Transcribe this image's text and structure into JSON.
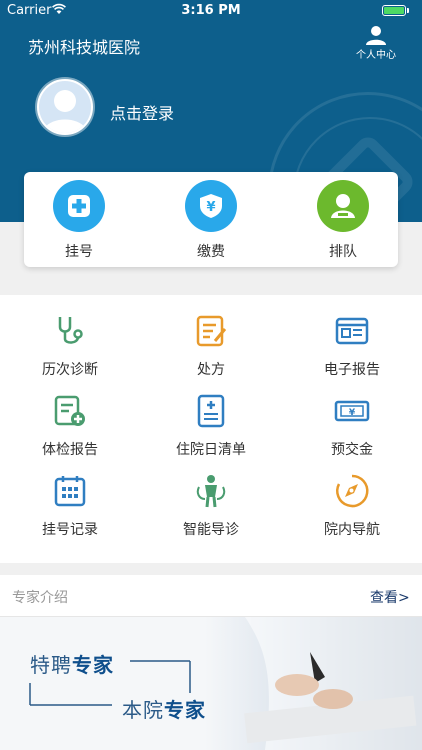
{
  "status_bar": {
    "carrier": "Carrier",
    "time": "3:16 PM",
    "battery_level": 1.0
  },
  "header": {
    "title": "苏州科技城医院",
    "personal_center_label": "个人中心",
    "login_text": "点击登录"
  },
  "quick_actions": [
    {
      "label": "挂号",
      "icon": "plus-badge-icon",
      "color": "#29a8ea"
    },
    {
      "label": "缴费",
      "icon": "yen-shield-icon",
      "color": "#29a8ea"
    },
    {
      "label": "排队",
      "icon": "person-queue-icon",
      "color": "#6cb92d"
    }
  ],
  "services": [
    {
      "label": "历次诊断",
      "icon": "stethoscope-icon"
    },
    {
      "label": "处方",
      "icon": "prescription-icon"
    },
    {
      "label": "电子报告",
      "icon": "e-report-icon"
    },
    {
      "label": "体检报告",
      "icon": "checkup-report-icon"
    },
    {
      "label": "住院日清单",
      "icon": "inpatient-list-icon"
    },
    {
      "label": "预交金",
      "icon": "deposit-icon"
    },
    {
      "label": "挂号记录",
      "icon": "calendar-record-icon"
    },
    {
      "label": "智能导诊",
      "icon": "guide-person-icon"
    },
    {
      "label": "院内导航",
      "icon": "compass-icon"
    }
  ],
  "experts": {
    "section_title": "专家介绍",
    "view_more": "查看>",
    "banner": {
      "line1_a": "特聘",
      "line1_b": "专家",
      "line2_a": "本院",
      "line2_b": "专家"
    }
  },
  "colors": {
    "header_bg": "#0d5f8c",
    "green": "#4a9c6f",
    "orange": "#e89a2b",
    "blue": "#2f7ec1"
  }
}
